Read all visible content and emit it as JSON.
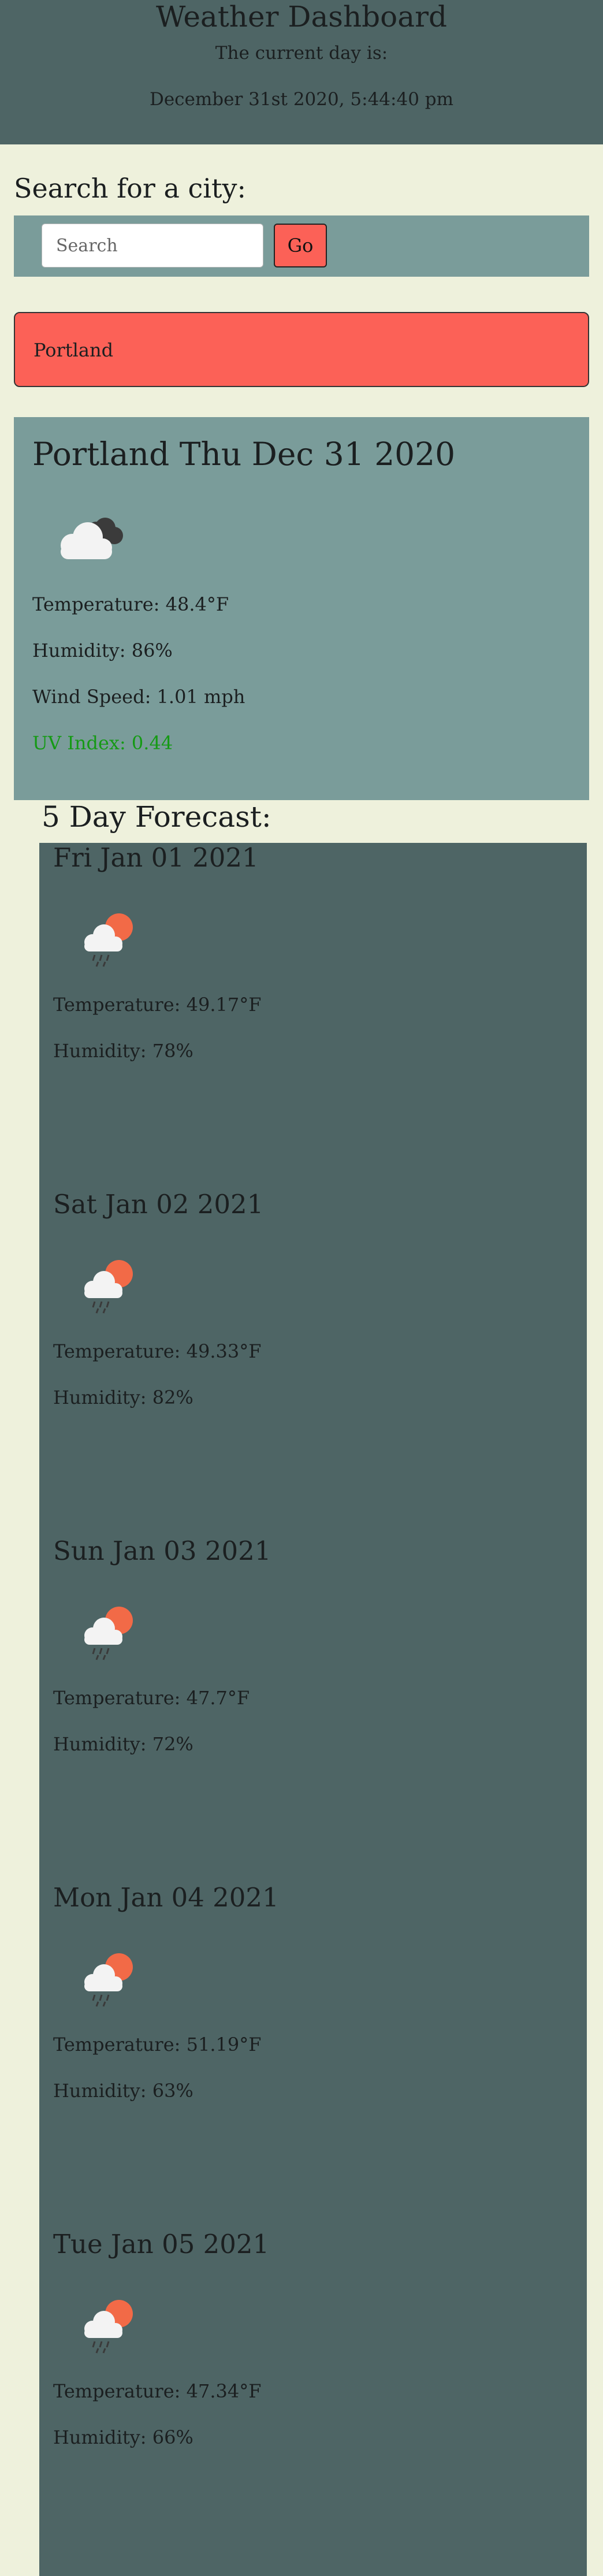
{
  "header": {
    "title": "Weather Dashboard",
    "subtitle": "The current day is:",
    "datetime": "December 31st 2020, 5:44:40 pm"
  },
  "search": {
    "heading": "Search for a city:",
    "placeholder": "Search",
    "button_label": "Go"
  },
  "history": [
    {
      "city": "Portland"
    }
  ],
  "current": {
    "title": "Portland Thu Dec 31 2020",
    "icon": "cloudy-icon",
    "temperature": "Temperature: 48.4°F",
    "humidity": "Humidity: 86%",
    "wind": "Wind Speed: 1.01 mph",
    "uv": "UV Index: 0.44",
    "uv_color": "#159a15"
  },
  "forecast": {
    "heading": "5 Day Forecast:",
    "days": [
      {
        "date": "Fri Jan 01 2021",
        "icon": "rain-sun-icon",
        "temperature": "Temperature: 49.17°F",
        "humidity": "Humidity: 78%"
      },
      {
        "date": "Sat Jan 02 2021",
        "icon": "rain-sun-icon",
        "temperature": "Temperature: 49.33°F",
        "humidity": "Humidity: 82%"
      },
      {
        "date": "Sun Jan 03 2021",
        "icon": "rain-sun-icon",
        "temperature": "Temperature: 47.7°F",
        "humidity": "Humidity: 72%"
      },
      {
        "date": "Mon Jan 04 2021",
        "icon": "rain-sun-icon",
        "temperature": "Temperature: 51.19°F",
        "humidity": "Humidity: 63%"
      },
      {
        "date": "Tue Jan 05 2021",
        "icon": "rain-sun-icon",
        "temperature": "Temperature: 47.34°F",
        "humidity": "Humidity: 66%"
      }
    ]
  },
  "colors": {
    "header_bg": "#4e6565",
    "page_bg": "#eef1dc",
    "panel_bg": "#7a9c9a",
    "accent": "#fc6157",
    "uv_low": "#159a15"
  }
}
